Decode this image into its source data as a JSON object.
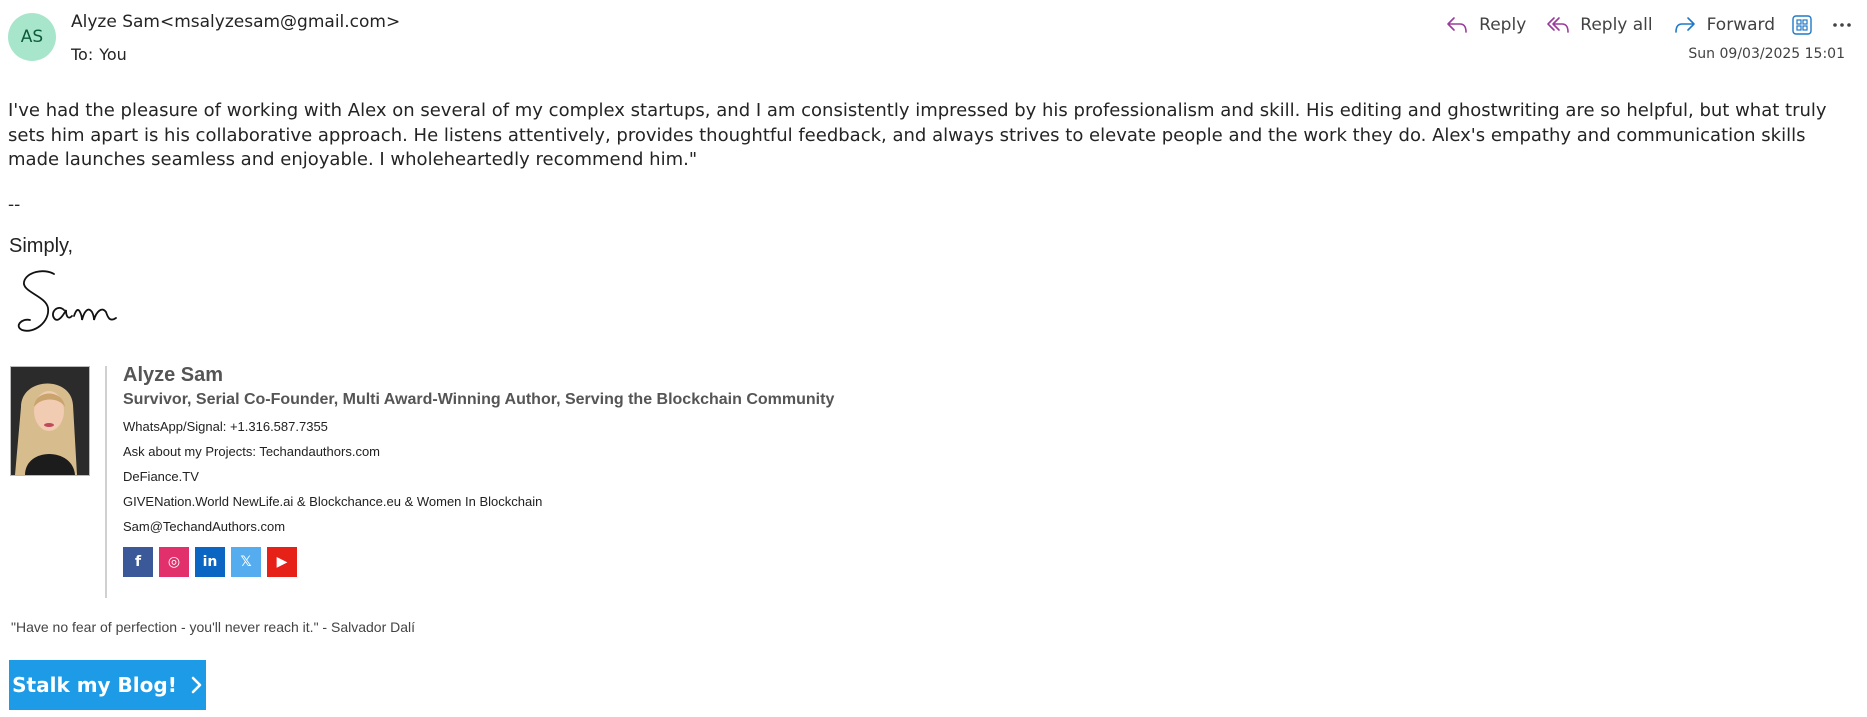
{
  "header": {
    "avatar_initials": "AS",
    "sender": "Alyze Sam<msalyzesam@gmail.com>",
    "to_label": "To:",
    "to_value": "You",
    "date": "Sun 09/03/2025 15:01",
    "actions": {
      "reply": "Reply",
      "reply_all": "Reply all",
      "forward": "Forward"
    }
  },
  "message": {
    "body": "I've had the pleasure of working with Alex on several of my complex startups, and I am consistently impressed by his professionalism and skill. His editing and ghostwriting are so helpful, but what truly sets him apart is his collaborative approach. He listens attentively, provides thoughtful feedback, and always strives to elevate people and the work they do. Alex's empathy and communication skills made launches seamless and enjoyable. I wholeheartedly recommend him.\"",
    "separator": "--",
    "closing": "Simply,",
    "signature_script": "Sam"
  },
  "signature_card": {
    "name": "Alyze Sam",
    "title": "Survivor, Serial Co-Founder, Multi Award-Winning Author, Serving the Blockchain Community",
    "lines": [
      "WhatsApp/Signal: +1.316.587.7355",
      "Ask about my Projects: Techandauthors.com",
      "DeFiance.TV",
      "GIVENation.World NewLife.ai & Blockchance.eu & Women In Blockchain",
      "Sam@TechandAuthors.com"
    ],
    "social": [
      {
        "icon": "facebook-icon",
        "glyph": "f",
        "color": "#3b5998"
      },
      {
        "icon": "instagram-icon",
        "glyph": "◎",
        "color": "#e1306c"
      },
      {
        "icon": "linkedin-icon",
        "glyph": "in",
        "color": "#0a66c2"
      },
      {
        "icon": "x-icon",
        "glyph": "𝕏",
        "color": "#55acee"
      },
      {
        "icon": "youtube-icon",
        "glyph": "▶",
        "color": "#e62117"
      }
    ]
  },
  "quote": "\"Have no fear of perfection - you'll never reach it.\" - Salvador Dalí",
  "blog_button": "Stalk my Blog!",
  "colors": {
    "avatar_bg": "#a8e6cb",
    "reply_icon": "#9b3b9b",
    "forward_icon": "#1f78c8",
    "blog_button": "#1d9be6"
  }
}
